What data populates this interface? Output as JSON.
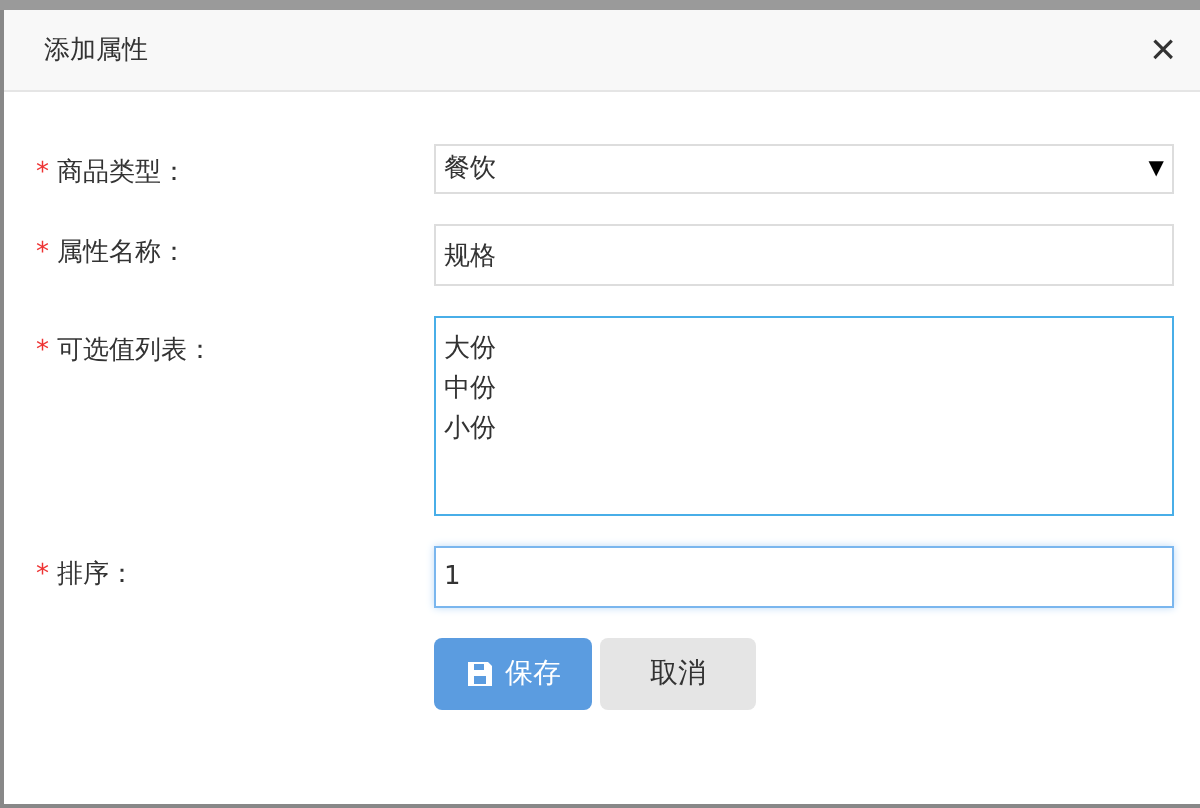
{
  "dialog": {
    "title": "添加属性",
    "close": "×"
  },
  "fields": [
    {
      "kind": "select",
      "label": "商品类型：",
      "required_mark": "*",
      "value": "餐饮",
      "caret": "▼"
    },
    {
      "kind": "input",
      "label": "属性名称：",
      "required_mark": "*",
      "value": "规格"
    },
    {
      "kind": "textarea",
      "label": "可选值列表：",
      "required_mark": "*",
      "lines": [
        "大份",
        "中份",
        "小份"
      ]
    },
    {
      "kind": "input",
      "label": "排序：",
      "required_mark": "*",
      "value": "1",
      "focused": true
    }
  ],
  "buttons": [
    {
      "kind": "primary",
      "label": "保存"
    },
    {
      "kind": "default",
      "label": "取消"
    }
  ]
}
